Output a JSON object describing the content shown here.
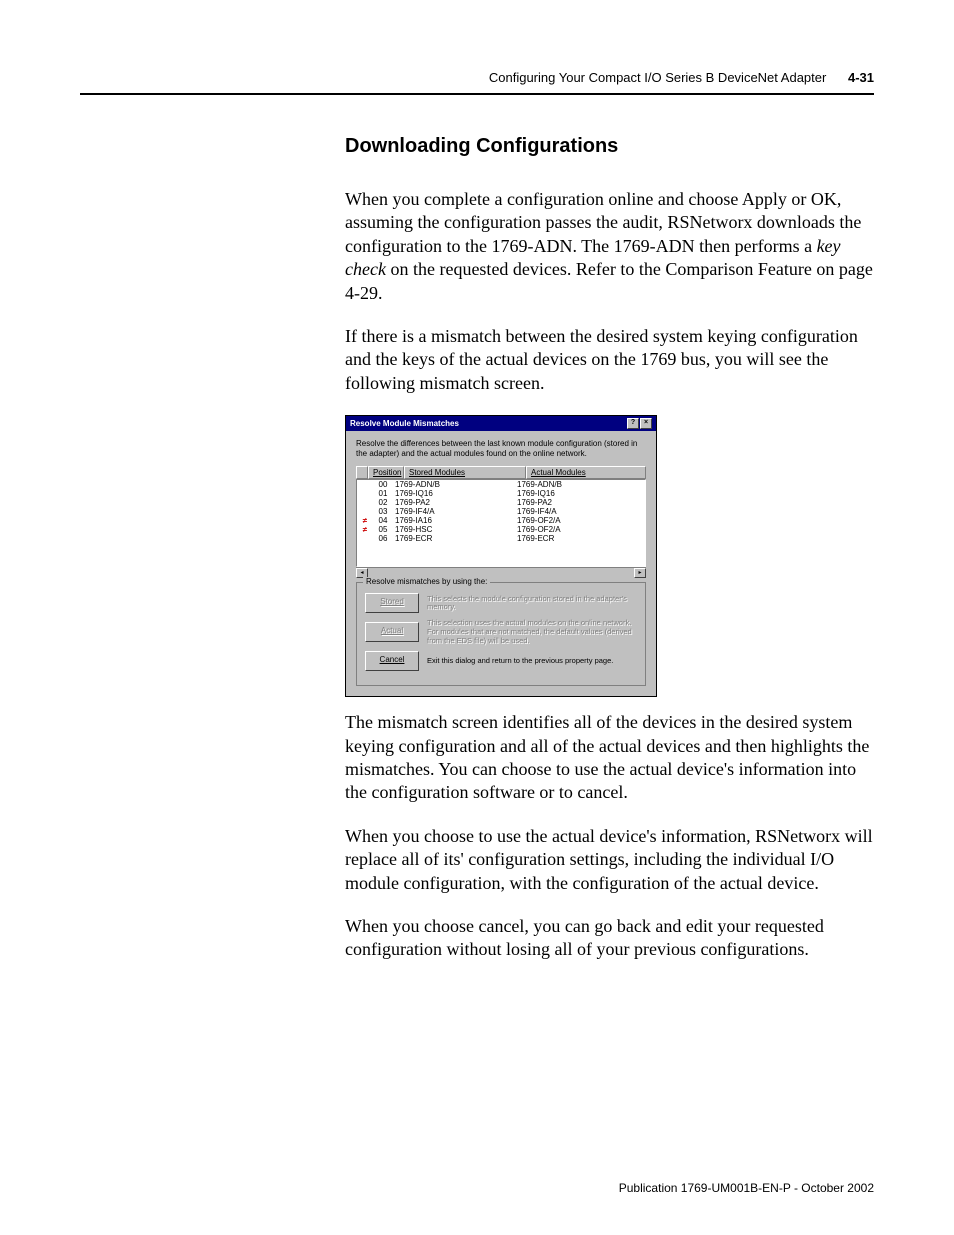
{
  "header": {
    "running": "Configuring Your Compact I/O Series B DeviceNet Adapter",
    "pagenum": "4-31"
  },
  "section_title": "Downloading Configurations",
  "para1_a": "When you complete a configuration online and choose Apply or OK, assuming the configuration passes the audit, RSNetworx downloads the configuration to the 1769-ADN. The 1769-ADN then performs a ",
  "para1_key": "key check",
  "para1_b": " on the requested devices. Refer to the Comparison Feature on page 4-29.",
  "para2": "If there is a mismatch between the desired system keying configuration and the keys of the actual devices on the 1769 bus, you will see the following mismatch screen.",
  "dialog": {
    "title": "Resolve Module Mismatches",
    "intro": "Resolve the differences between the last known module configuration (stored in the adapter) and the actual modules found on the online network.",
    "col_position": "Position",
    "col_stored": "Stored Modules",
    "col_actual": "Actual Modules",
    "rows": [
      {
        "mark": "",
        "pos": "00",
        "stored": "1769-ADN/B",
        "actual": "1769-ADN/B"
      },
      {
        "mark": "",
        "pos": "01",
        "stored": "1769-IQ16",
        "actual": "1769-IQ16"
      },
      {
        "mark": "",
        "pos": "02",
        "stored": "1769-PA2",
        "actual": "1769-PA2"
      },
      {
        "mark": "",
        "pos": "03",
        "stored": "1769-IF4/A",
        "actual": "1769-IF4/A"
      },
      {
        "mark": "≠",
        "pos": "04",
        "stored": "1769-IA16",
        "actual": "1769-OF2/A"
      },
      {
        "mark": "≠",
        "pos": "05",
        "stored": "1769-HSC",
        "actual": "1769-OF2/A"
      },
      {
        "mark": "",
        "pos": "06",
        "stored": "1769-ECR",
        "actual": "1769-ECR"
      }
    ],
    "group_label": "Resolve mismatches by using the:",
    "btn_stored": "Stored",
    "btn_stored_desc": "This selects the module configuration stored in the adapter's memory.",
    "btn_actual": "Actual",
    "btn_actual_desc": "This selection uses the actual modules on the online network. For modules that are not matched, the default values (derived from the EDS file) will be used.",
    "btn_cancel": "Cancel",
    "btn_cancel_desc": "Exit this dialog and return to the previous property page."
  },
  "para3": "The mismatch screen identifies all of the devices in the desired system keying configuration and all of the actual devices and then highlights the mismatches. You can choose to use the actual device's information into the configuration software or to cancel.",
  "para4": "When you choose to use the actual device's information, RSNetworx will replace all of its' configuration settings, including the individual I/O module configuration, with the configuration of the actual device.",
  "para5": "When you choose cancel, you can go back and edit your requested configuration without losing all of your previous configurations.",
  "footer": "Publication 1769-UM001B-EN-P - October 2002"
}
